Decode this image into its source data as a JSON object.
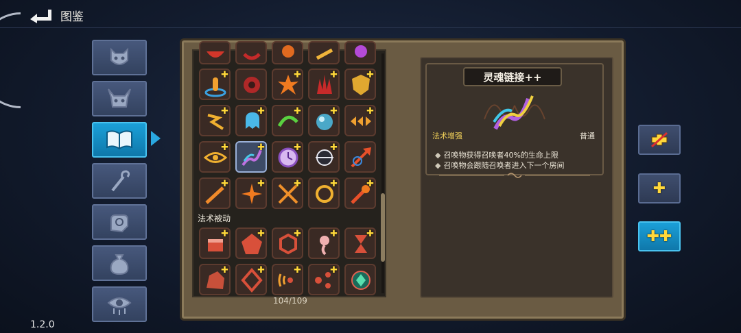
{
  "header": {
    "title": "图鉴"
  },
  "version": "1.2.0",
  "categories": [
    {
      "icon": "demon-face-icon"
    },
    {
      "icon": "horned-mask-icon"
    },
    {
      "icon": "open-book-icon",
      "active": true
    },
    {
      "icon": "magic-staff-icon"
    },
    {
      "icon": "spell-hand-icon"
    },
    {
      "icon": "pouch-icon"
    },
    {
      "icon": "eye-icon"
    }
  ],
  "grid": {
    "section_passive_label": "法术被动",
    "count_label": "104/109"
  },
  "detail": {
    "title": "灵魂链接++",
    "tag_type": "法术增强",
    "tag_rarity": "普通",
    "bullets": [
      "召唤物获得召唤者40%的生命上限",
      "召唤物会跟随召唤者进入下一个房间"
    ]
  },
  "upgrade_buttons": [
    {
      "label": "",
      "icon": "no-plus-icon"
    },
    {
      "label": "✚",
      "icon": "single-plus-icon"
    },
    {
      "label": "✚✚",
      "icon": "double-plus-icon",
      "active": true
    }
  ],
  "colors": {
    "accent_blue": "#1ba0d8",
    "plus_yellow": "#ffd83a",
    "frame_brown": "#6a5b43"
  }
}
